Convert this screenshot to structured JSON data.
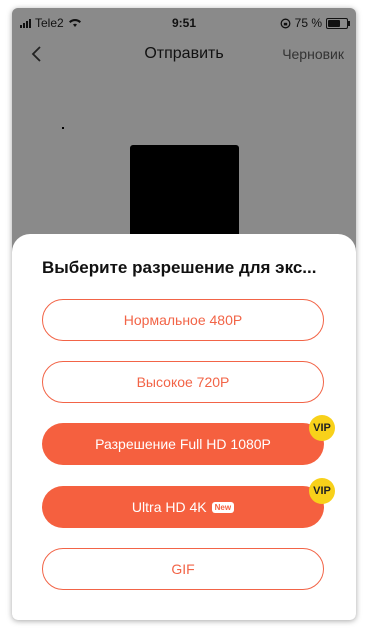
{
  "status": {
    "carrier": "Tele2",
    "time": "9:51",
    "battery": "75 %",
    "battery_level": 0.75
  },
  "nav": {
    "title": "Отправить",
    "draft": "Черновик",
    "back_icon": "chevron-left-icon"
  },
  "sheet": {
    "title": "Выберите разрешение для экс...",
    "options": [
      {
        "label": "Нормальное 480P"
      },
      {
        "label": "Высокое 720P"
      },
      {
        "label": "Разрешение Full HD 1080P",
        "badge": "VIP"
      },
      {
        "label": "Ultra HD 4K",
        "tag": "New",
        "badge": "VIP"
      },
      {
        "label": "GIF"
      }
    ]
  },
  "colors": {
    "accent": "#f5603f",
    "vip": "#f8d11a",
    "overlay": "#8a8a8a"
  }
}
